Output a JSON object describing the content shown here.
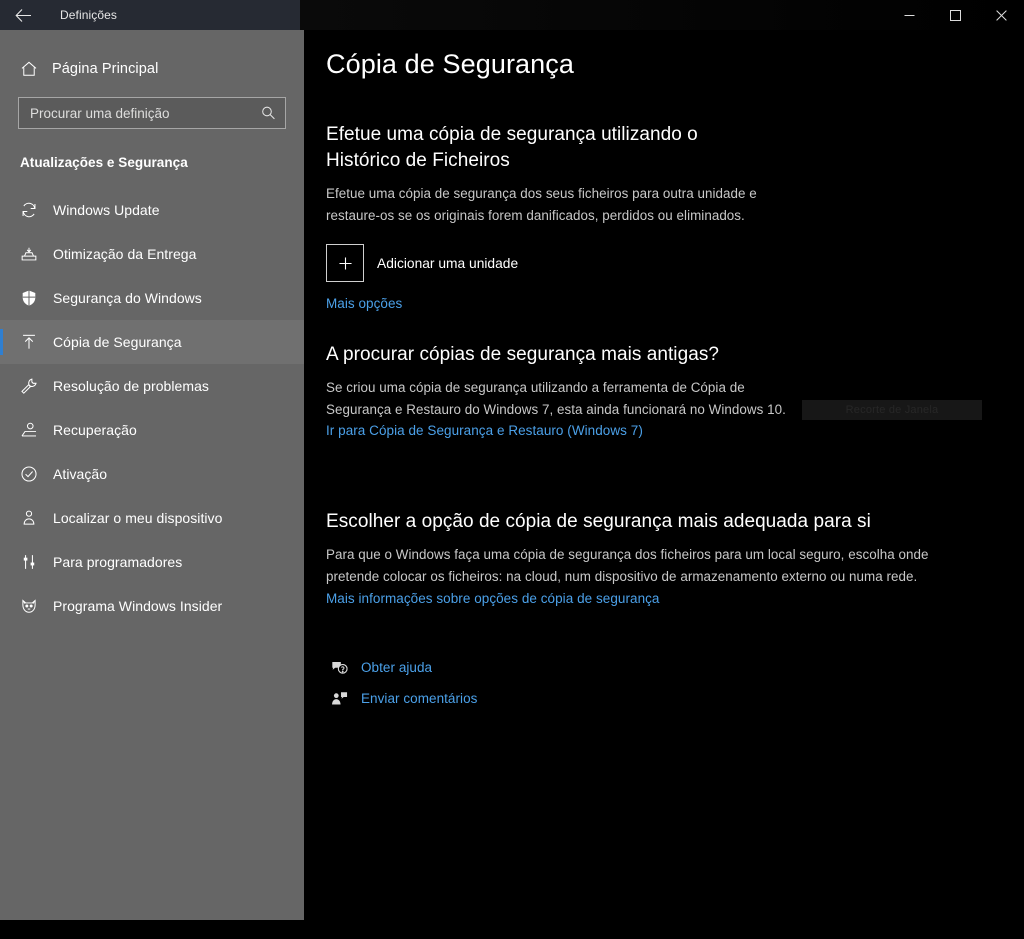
{
  "window": {
    "title": "Definições",
    "back_icon": "back-arrow-icon",
    "controls": {
      "minimize": "minimize-icon",
      "maximize": "maximize-icon",
      "close": "close-icon"
    }
  },
  "sidebar": {
    "home": {
      "label": "Página Principal",
      "icon": "home-icon"
    },
    "search": {
      "placeholder": "Procurar uma definição",
      "value": "",
      "icon": "search-icon"
    },
    "category_title": "Atualizações e Segurança",
    "items": [
      {
        "label": "Windows Update",
        "icon": "refresh-icon",
        "selected": false
      },
      {
        "label": "Otimização da Entrega",
        "icon": "delivery-icon",
        "selected": false
      },
      {
        "label": "Segurança do Windows",
        "icon": "shield-icon",
        "selected": false
      },
      {
        "label": "Cópia de Segurança",
        "icon": "upload-arrow-icon",
        "selected": true
      },
      {
        "label": "Resolução de problemas",
        "icon": "wrench-icon",
        "selected": false
      },
      {
        "label": "Recuperação",
        "icon": "recovery-icon",
        "selected": false
      },
      {
        "label": "Ativação",
        "icon": "check-circle-icon",
        "selected": false
      },
      {
        "label": "Localizar o meu dispositivo",
        "icon": "person-pin-icon",
        "selected": false
      },
      {
        "label": "Para programadores",
        "icon": "developer-tools-icon",
        "selected": false
      },
      {
        "label": "Programa Windows Insider",
        "icon": "insider-cat-icon",
        "selected": false
      }
    ]
  },
  "main": {
    "page_title": "Cópia de Segurança",
    "section_file_history": {
      "heading": "Efetue uma cópia de segurança utilizando o Histórico de Ficheiros",
      "body": "Efetue uma cópia de segurança dos seus ficheiros para outra unidade e restaure-os se os originais forem danificados, perdidos ou eliminados.",
      "add_drive_label": "Adicionar uma unidade",
      "add_drive_icon": "plus-icon",
      "more_options_link": "Mais opções"
    },
    "section_older_backups": {
      "heading": "A procurar cópias de segurança mais antigas?",
      "body": "Se criou uma cópia de segurança utilizando a ferramenta de Cópia de Segurança e Restauro do Windows 7, esta ainda funcionará no Windows 10.",
      "link": "Ir para Cópia de Segurança e Restauro (Windows 7)"
    },
    "ghost_overlay": {
      "label": "Recorte de Janela"
    },
    "section_choose_option": {
      "heading": "Escolher a opção de cópia de segurança mais adequada para si",
      "body": "Para que o Windows faça uma cópia de segurança dos ficheiros para um local seguro, escolha onde pretende colocar os ficheiros: na cloud, num dispositivo de armazenamento externo ou numa rede.",
      "link": "Mais informações sobre opções de cópia de segurança"
    },
    "help_links": [
      {
        "label": "Obter ajuda",
        "icon": "help-chat-icon"
      },
      {
        "label": "Enviar comentários",
        "icon": "feedback-person-icon"
      }
    ]
  },
  "colors": {
    "accent": "#2f7fd1",
    "link": "#4ba0e8",
    "sidebar_bg": "#666666",
    "content_bg": "#000000",
    "titlebar_bg": "#262a33"
  }
}
